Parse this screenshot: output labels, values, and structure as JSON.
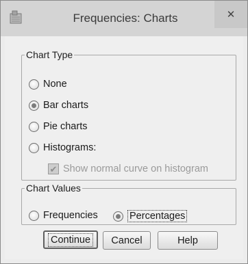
{
  "window": {
    "title": "Frequencies: Charts",
    "app_icon": "spss-dialog-icon",
    "close_icon": "close-x-icon"
  },
  "chart_type": {
    "legend": "Chart Type",
    "options": [
      {
        "label": "None",
        "selected": false
      },
      {
        "label": "Bar charts",
        "selected": true
      },
      {
        "label": "Pie charts",
        "selected": false
      },
      {
        "label": "Histograms:",
        "selected": false
      }
    ],
    "normal_curve": {
      "label": "Show normal curve on histogram",
      "checked": true,
      "enabled": false
    }
  },
  "chart_values": {
    "legend": "Chart Values",
    "options": [
      {
        "label": "Frequencies",
        "selected": false
      },
      {
        "label": "Percentages",
        "selected": true
      }
    ]
  },
  "buttons": {
    "continue": "Continue",
    "cancel": "Cancel",
    "help": "Help"
  }
}
